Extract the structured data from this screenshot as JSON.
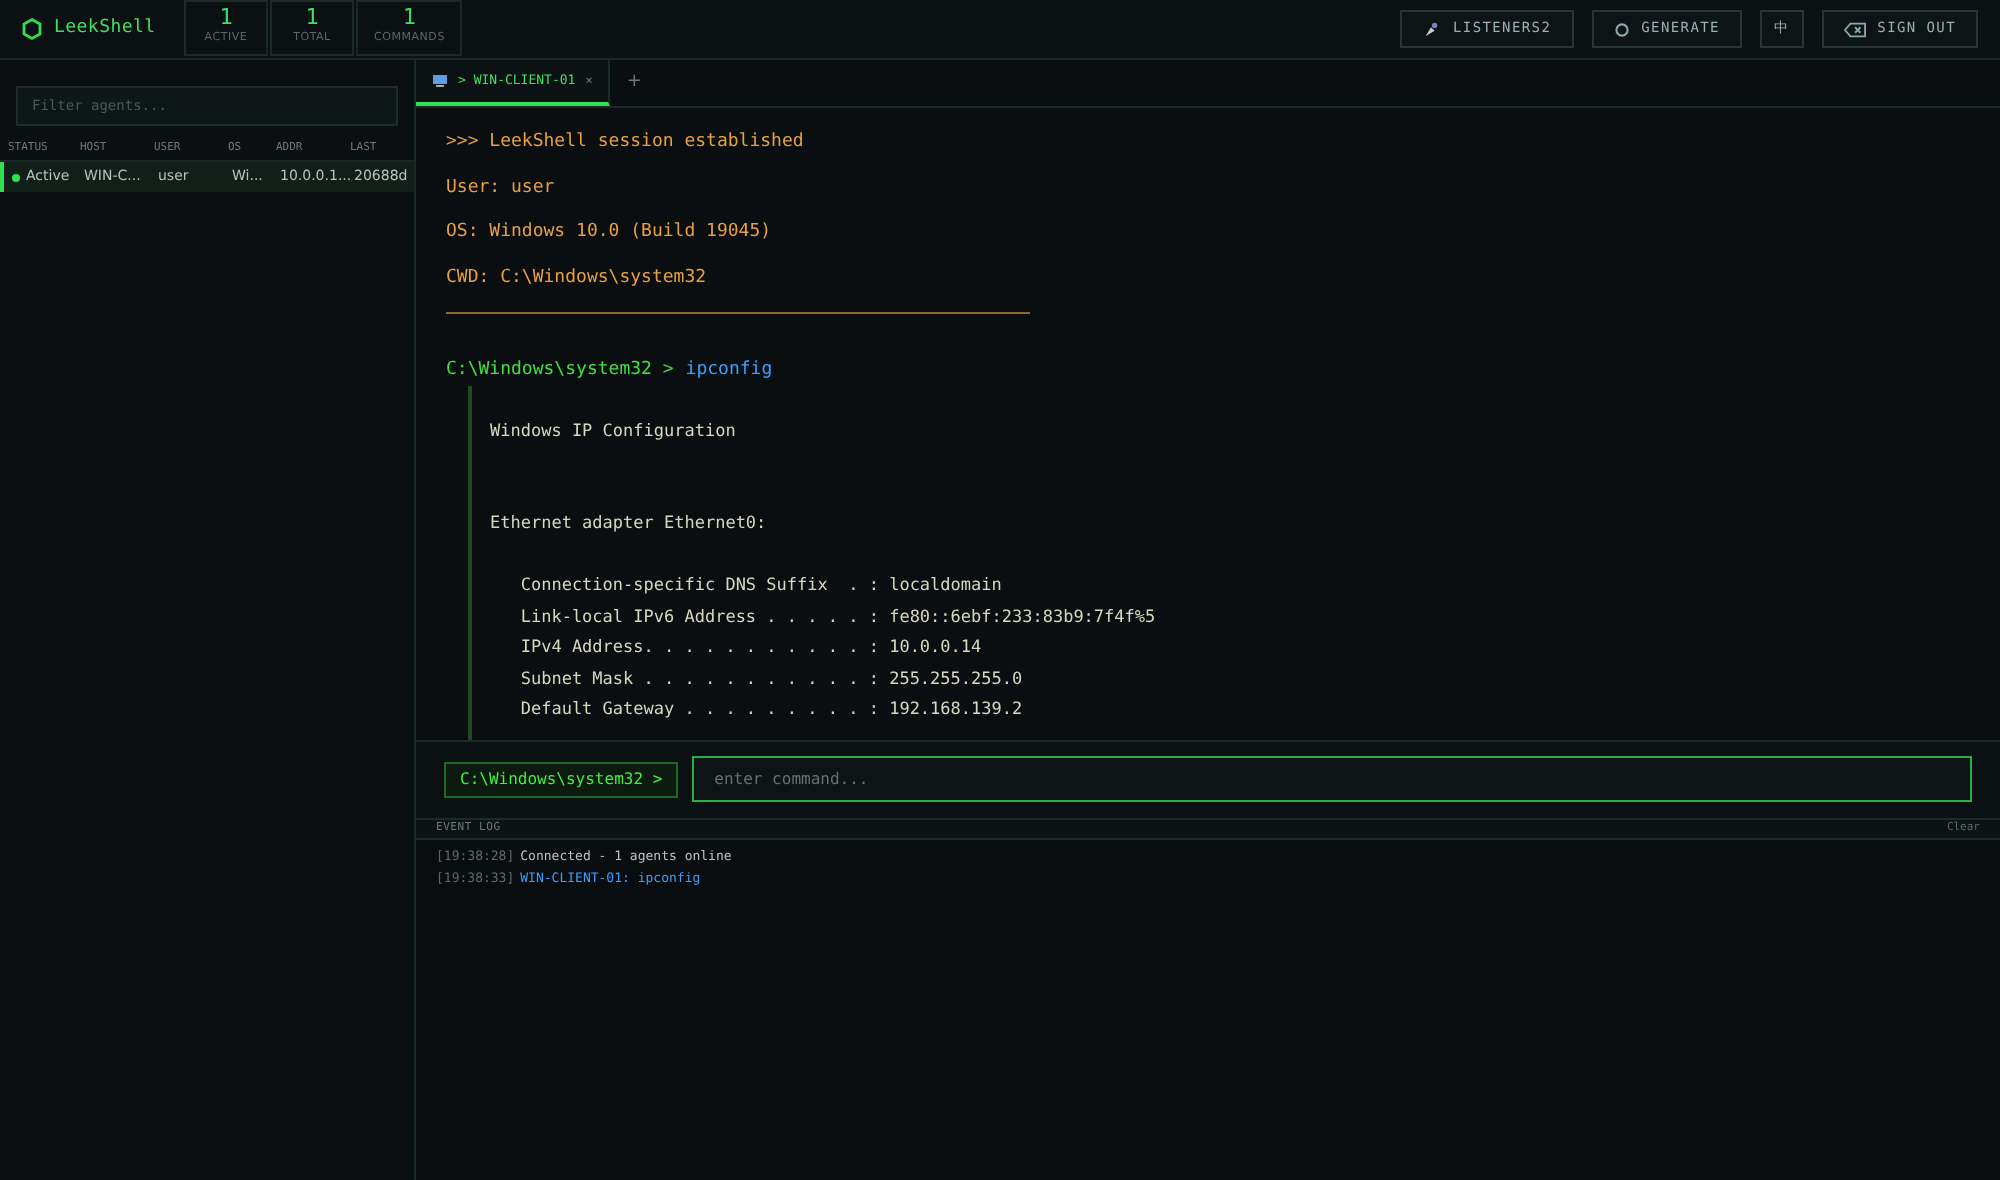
{
  "app": {
    "name": "LeekShell"
  },
  "stats": [
    {
      "value": "1",
      "label": "ACTIVE"
    },
    {
      "value": "1",
      "label": "TOTAL"
    },
    {
      "value": "1",
      "label": "COMMANDS"
    }
  ],
  "header_buttons": [
    {
      "kind": "listeners",
      "label": "LISTENERS2"
    },
    {
      "kind": "generate",
      "label": "GENERATE"
    },
    {
      "kind": "language",
      "label": "中"
    },
    {
      "kind": "signout",
      "label": "SIGN OUT"
    }
  ],
  "sidebar": {
    "filter": {
      "placeholder": "Filter agents..."
    },
    "columns": [
      "STATUS",
      "HOST",
      "USER",
      "OS",
      "ADDR",
      "LAST"
    ],
    "rows": [
      {
        "selected": true,
        "status": "Active",
        "host": "WIN-C...",
        "user": "user",
        "os": "Wi...",
        "addr": "10.0.0.1...",
        "last": "20688d"
      }
    ]
  },
  "tabs": [
    {
      "label": "> WIN-CLIENT-01",
      "close": "×",
      "selected": true
    }
  ],
  "new_tab": "+",
  "terminal": {
    "lines": [
      {
        "kind": "info",
        "text": ">>> LeekShell session established"
      },
      {
        "kind": "info",
        "text": "User: user"
      },
      {
        "kind": "info",
        "text": "OS: Windows 10.0 (Build 19045)"
      },
      {
        "kind": "info",
        "text": "CWD: C:\\Windows\\system32"
      },
      {
        "kind": "divider"
      },
      {
        "kind": "prompt",
        "prompt": "C:\\Windows\\system32 >",
        "command": "ipconfig"
      },
      {
        "kind": "output",
        "text": "\nWindows IP Configuration\n\n\nEthernet adapter Ethernet0:\n\n   Connection-specific DNS Suffix  . : localdomain\n   Link-local IPv6 Address . . . . . : fe80::6ebf:233:83b9:7f4f%5\n   IPv4 Address. . . . . . . . . . . : 10.0.0.14\n   Subnet Mask . . . . . . . . . . . : 255.255.255.0\n   Default Gateway . . . . . . . . . : 192.168.139.2\n"
      }
    ]
  },
  "command_bar": {
    "prompt": "C:\\Windows\\system32 >",
    "placeholder": "enter command..."
  },
  "event_log": {
    "title": "EVENT LOG",
    "clear": "Clear",
    "entries": [
      {
        "kind": "system",
        "time": "[19:38:28]",
        "message": "Connected - 1 agents online"
      },
      {
        "kind": "command",
        "time": "[19:38:33]",
        "message": "WIN-CLIENT-01: ipconfig"
      }
    ]
  }
}
